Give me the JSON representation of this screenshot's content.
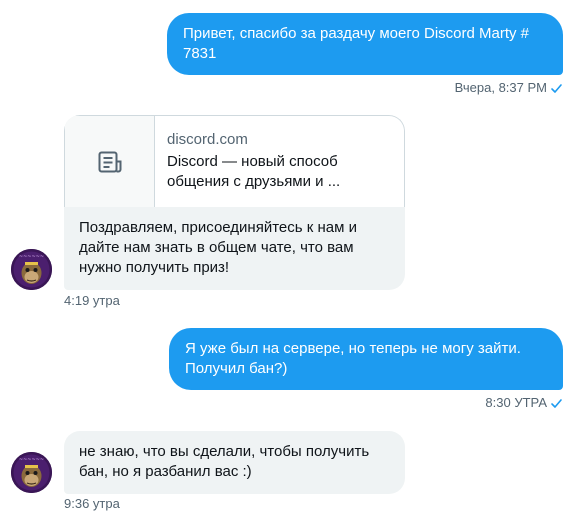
{
  "messages": {
    "m1": {
      "text": "Привет, спасибо за раздачу моего Discord Marty # 7831",
      "time": "Вчера, 8:37 PM"
    },
    "m2": {
      "card_domain": "discord.com",
      "card_desc": "Discord — новый способ общения с друзьями и ...",
      "text": "Поздравляем, присоединяйтесь к нам и дайте нам знать в общем чате, что вам нужно получить приз!",
      "time": "4:19 утра"
    },
    "m3": {
      "text": "Я уже был на сервере, но теперь не могу зайти. Получил бан?)",
      "time": "8:30 УТРА"
    },
    "m4": {
      "text": "не знаю, что вы сделали, чтобы получить бан, но я разбанил вас :)",
      "time": "9:36 утра"
    }
  },
  "icons": {
    "read_receipt": "check-icon",
    "link_preview": "document-icon",
    "avatar": "avatar"
  },
  "colors": {
    "accent": "#1d9bf0",
    "incoming_bubble": "#eff3f4",
    "meta_text": "#536471"
  }
}
